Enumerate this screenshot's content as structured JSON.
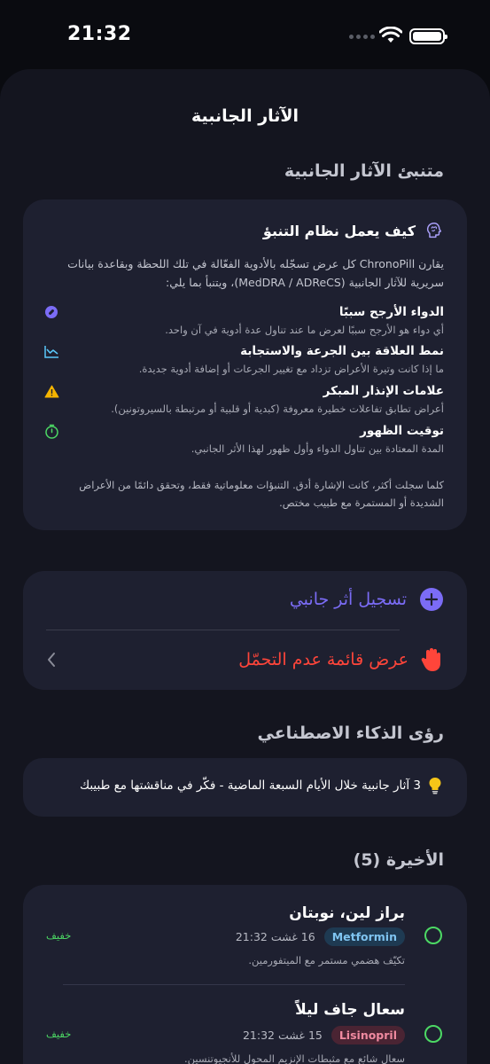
{
  "status_bar": {
    "time": "21:32"
  },
  "sheet": {
    "title": "الآثار الجانبية"
  },
  "predictor": {
    "section_title": "متنبئ الآثار الجانبية",
    "heading": "كيف يعمل نظام التنبؤ",
    "intro": "يقارن ChronoPill كل عرض تسجّله بالأدوية الفعّالة في تلك اللحظة وبقاعدة بيانات سريرية للآثار الجانبية (MedDRA / ADReCS)، ويتنبأ بما يلي:",
    "items": [
      {
        "title": "الدواء الأرجح سببًا",
        "desc": "أي دواء هو الأرجح سببًا لعرض ما عند تناول عدة أدوية في آن واحد.",
        "icon": "pill-icon",
        "color": "#7b6cf6"
      },
      {
        "title": "نمط العلاقة بين الجرعة والاستجابة",
        "desc": "ما إذا كانت وتيرة الأعراض تزداد مع تغيير الجرعات أو إضافة أدوية جديدة.",
        "icon": "trend-chart-icon",
        "color": "#5ac8fa"
      },
      {
        "title": "علامات الإنذار المبكر",
        "desc": "أعراض تطابق تفاعلات خطيرة معروفة (كبدية أو قلبية أو مرتبطة بالسيروتونين).",
        "icon": "warning-icon",
        "color": "#f5b400"
      },
      {
        "title": "توقيت الظهور",
        "desc": "المدة المعتادة بين تناول الدواء وأول ظهور لهذا الأثر الجانبي.",
        "icon": "timer-icon",
        "color": "#4cd964"
      }
    ],
    "footer": "كلما سجلت أكثر، كانت الإشارة أدق. التنبؤات معلوماتية فقط، وتحقق دائمًا من الأعراض الشديدة أو المستمرة مع طبيب مختص."
  },
  "actions": {
    "log_label": "تسجيل أثر جانبي",
    "log_color": "#7b6cf6",
    "intolerance_label": "عرض قائمة عدم التحمّل",
    "intolerance_color": "#ff453a"
  },
  "ai": {
    "section_title": "رؤى الذكاء الاصطناعي",
    "insight": "3 آثار جانبية خلال الأيام السبعة الماضية - فكّر في مناقشتها مع طبيبك",
    "icon": "lightbulb-icon"
  },
  "recent": {
    "section_title": "الأخيرة (5)",
    "items": [
      {
        "title": "براز لين، نوبتان",
        "drug": "Metformin",
        "date": "16 غشت 21:32",
        "desc": "تكيّف هضمي مستمر مع الميتفورمين.",
        "severity": "خفيف",
        "pill_bg": "#1e3a52",
        "pill_fg": "#7fc4f0"
      },
      {
        "title": "سعال جاف ليلاً",
        "drug": "Lisinopril",
        "date": "15 غشت 21:32",
        "desc": "سعال شائع مع مثبطات الإنزيم المحول للأنجيوتنسين.",
        "severity": "خفيف",
        "pill_bg": "#4a2433",
        "pill_fg": "#f08aa0"
      }
    ]
  }
}
